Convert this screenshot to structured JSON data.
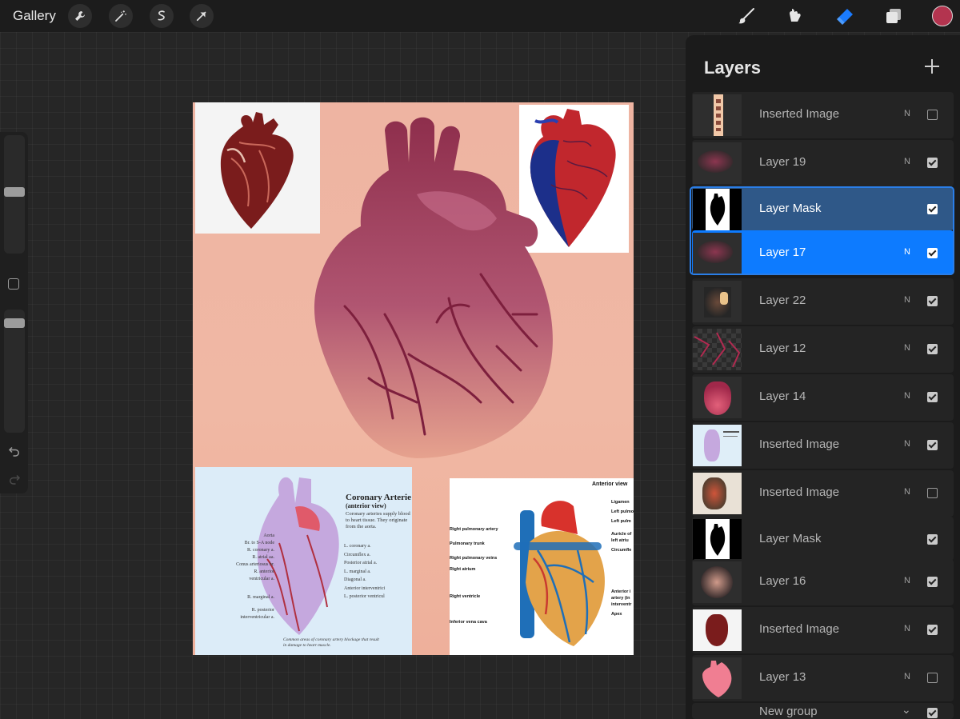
{
  "topbar": {
    "gallery_label": "Gallery",
    "left_tools": [
      "wrench-icon",
      "magic-wand-icon",
      "selection-icon",
      "transform-arrow-icon"
    ],
    "right_tools": [
      "brush-icon",
      "smudge-icon",
      "eraser-icon",
      "layers-icon"
    ],
    "active_tool": "eraser-icon",
    "accent_color": "#1a7bff",
    "current_color": "#b3344f"
  },
  "sidebar": {
    "size_slider_value": 0.42,
    "opacity_slider_value": 0.06,
    "controls": [
      "size-slider",
      "modify-button",
      "opacity-slider",
      "undo-icon",
      "redo-icon"
    ]
  },
  "canvas": {
    "background_color": "#efb29e",
    "images": [
      "heart-photo-top-left",
      "vascular-cast-top-right",
      "main-heart-illustration",
      "coronary-arteries-diagram",
      "anterior-view-diagram"
    ],
    "coronary_diagram": {
      "title": "Coronary Arterie",
      "subtitle": "(anterior view)",
      "description": "Coronary arteries supply blood to heart tissue. They originate from the aorta.",
      "labels_left": [
        "Aorta",
        "Br. to S-A node",
        "R. coronary a.",
        "R. atrial aa.",
        "Conus arteriosus br.",
        "R. anterior",
        "ventricular a.",
        "R. marginal a.",
        "R. posterior",
        "interventricular a."
      ],
      "labels_right": [
        "L. coronary a.",
        "Circumflex a.",
        "Posterior atrial a.",
        "L. marginal a.",
        "Diagonal a.",
        "Anterior interventrici",
        "L. posterior ventricul"
      ],
      "footnote": "Common areas of coronary artery blockage that result in damage to heart muscle."
    },
    "anterior_diagram": {
      "title": "Anterior view",
      "labels_left": [
        "Right pulmonary artery",
        "Pulmonary trunk",
        "Right pulmonary veins",
        "Right atrium",
        "Right ventricle",
        "Inferior vena cava"
      ],
      "labels_right": [
        "Ligamen",
        "Left pulmo",
        "Left pulm",
        "Auricle of left atriu",
        "Circumfle",
        "Anterior i artery (in interventr",
        "Apex"
      ]
    }
  },
  "layers_panel": {
    "title": "Layers",
    "add_icon": "plus-icon",
    "active_layer": "Layer 17",
    "layers": [
      {
        "name": "Inserted Image",
        "blend": "N",
        "visible": false,
        "thumb": "strip"
      },
      {
        "name": "Layer 19",
        "blend": "N",
        "visible": true,
        "thumb": "blur-pink"
      },
      {
        "name": "Layer Mask",
        "blend": "",
        "visible": true,
        "thumb": "mask",
        "state": "mask-active"
      },
      {
        "name": "Layer 17",
        "blend": "N",
        "visible": true,
        "thumb": "blur-pink",
        "state": "active"
      },
      {
        "name": "Layer 22",
        "blend": "N",
        "visible": true,
        "thumb": "dark-veins"
      },
      {
        "name": "Layer 12",
        "blend": "N",
        "visible": true,
        "thumb": "checker-veins"
      },
      {
        "name": "Layer 14",
        "blend": "N",
        "visible": true,
        "thumb": "heart-pink"
      },
      {
        "name": "Inserted Image",
        "blend": "N",
        "visible": true,
        "thumb": "diagram-blue"
      },
      {
        "name": "Inserted Image",
        "blend": "N",
        "visible": false,
        "thumb": "diagram-beige"
      },
      {
        "name": "Layer Mask",
        "blend": "",
        "visible": true,
        "thumb": "mask"
      },
      {
        "name": "Layer 16",
        "blend": "N",
        "visible": true,
        "thumb": "blob-beige"
      },
      {
        "name": "Inserted Image",
        "blend": "N",
        "visible": true,
        "thumb": "heart-photo"
      },
      {
        "name": "Layer 13",
        "blend": "N",
        "visible": false,
        "thumb": "heart-silhouette"
      },
      {
        "name": "New group",
        "blend": "",
        "visible": true,
        "thumb": "group"
      }
    ]
  }
}
